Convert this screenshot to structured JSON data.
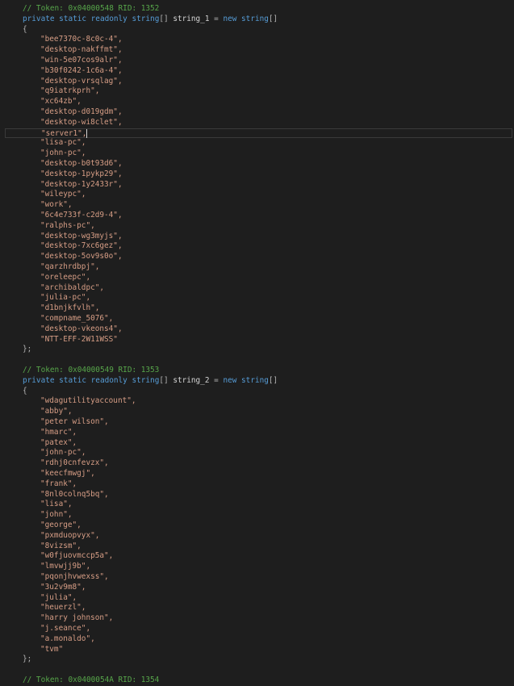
{
  "editor": {
    "blocks": [
      {
        "token_comment": "// Token: 0x04000548 RID: 1352",
        "declaration": {
          "modifiers": "private static readonly",
          "type": "string",
          "brackets": "[]",
          "name": "string_1",
          "equals": "=",
          "new_keyword": "new",
          "new_type": "string",
          "new_brackets": "[]"
        },
        "open_brace": "{",
        "values": [
          "\"bee7370c-8c0c-4\",",
          "\"desktop-nakffmt\",",
          "\"win-5e07cos9alr\",",
          "\"b30f0242-1c6a-4\",",
          "\"desktop-vrsqlag\",",
          "\"q9iatrkprh\",",
          "\"xc64zb\",",
          "\"desktop-d019gdm\",",
          "\"desktop-wi8clet\",",
          "\"server1\",",
          "\"lisa-pc\",",
          "\"john-pc\",",
          "\"desktop-b0t93d6\",",
          "\"desktop-1pykp29\",",
          "\"desktop-1y2433r\",",
          "\"wileypc\",",
          "\"work\",",
          "\"6c4e733f-c2d9-4\",",
          "\"ralphs-pc\",",
          "\"desktop-wg3myjs\",",
          "\"desktop-7xc6gez\",",
          "\"desktop-5ov9s0o\",",
          "\"qarzhrdbpj\",",
          "\"oreleepc\",",
          "\"archibaldpc\",",
          "\"julia-pc\",",
          "\"d1bnjkfvlh\",",
          "\"compname_5076\",",
          "\"desktop-vkeons4\",",
          "\"NTT-EFF-2W11WSS\""
        ],
        "close_brace": "};"
      },
      {
        "token_comment": "// Token: 0x04000549 RID: 1353",
        "declaration": {
          "modifiers": "private static readonly",
          "type": "string",
          "brackets": "[]",
          "name": "string_2",
          "equals": "=",
          "new_keyword": "new",
          "new_type": "string",
          "new_brackets": "[]"
        },
        "open_brace": "{",
        "values": [
          "\"wdagutilityaccount\",",
          "\"abby\",",
          "\"peter wilson\",",
          "\"hmarc\",",
          "\"patex\",",
          "\"john-pc\",",
          "\"rdhj0cnfevzx\",",
          "\"keecfmwgj\",",
          "\"frank\",",
          "\"8nl0colnq5bq\",",
          "\"lisa\",",
          "\"john\",",
          "\"george\",",
          "\"pxmduopvyx\",",
          "\"8vizsm\",",
          "\"w0fjuovmccp5a\",",
          "\"lmvwjj9b\",",
          "\"pqonjhvwexss\",",
          "\"3u2v9m8\",",
          "\"julia\",",
          "\"heuerzl\",",
          "\"harry johnson\",",
          "\"j.seance\",",
          "\"a.monaldo\",",
          "\"tvm\""
        ],
        "close_brace": "};"
      }
    ],
    "trailing_comment": "// Token: 0x0400054A RID: 1354",
    "current_line_value": "\"server1\","
  },
  "colors": {
    "background": "#1e1e1e",
    "comment": "#57a64a",
    "keyword": "#569cd6",
    "type": "#4ec9b0",
    "string": "#d69d85",
    "plain": "#d4d4d4"
  }
}
